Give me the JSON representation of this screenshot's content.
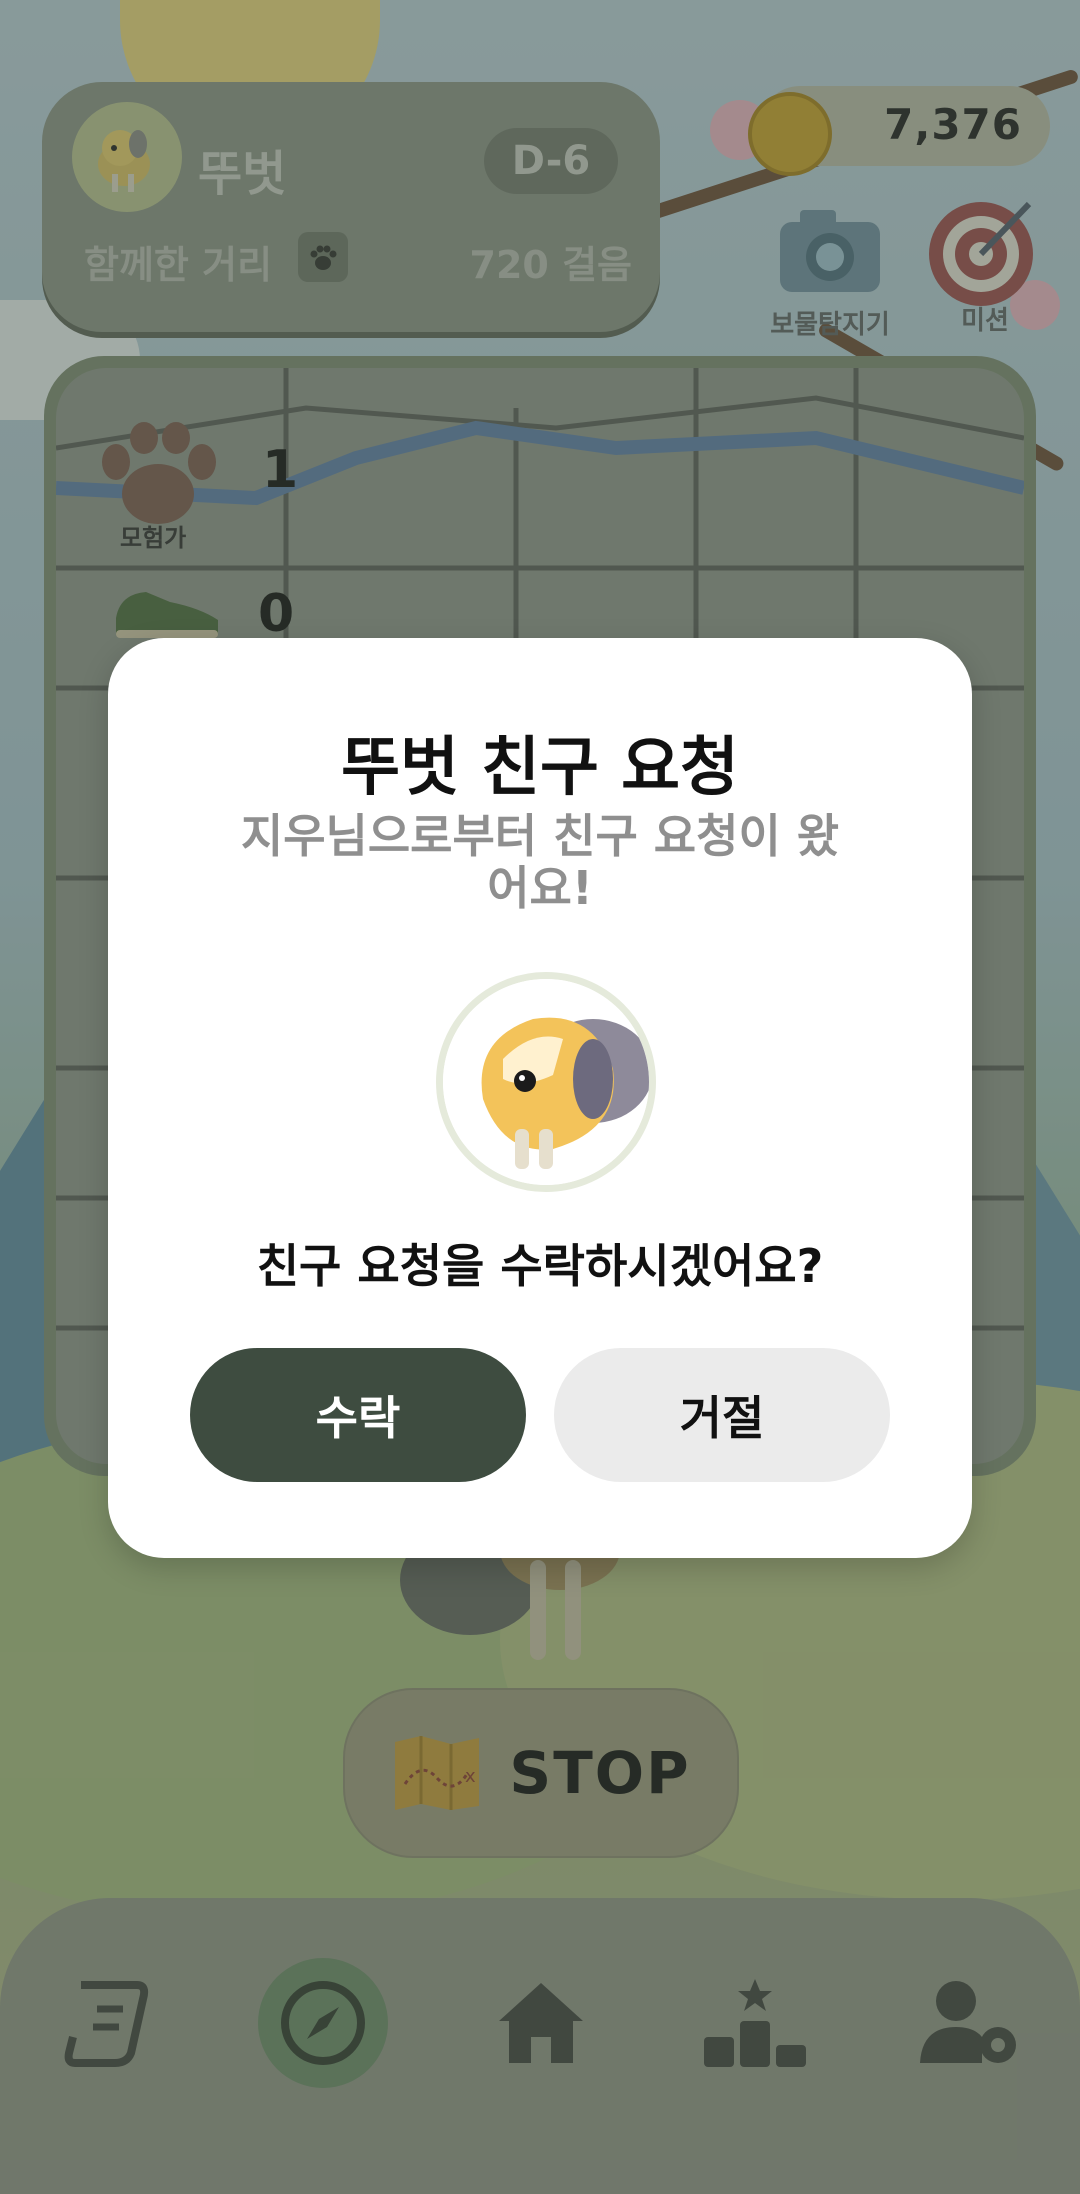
{
  "header": {
    "dog_name": "뚜벗",
    "d_day": "D-6",
    "distance_label": "함께한 거리",
    "steps": "720 걸음"
  },
  "coins": {
    "count": "7,376"
  },
  "quick_actions": [
    {
      "label": "보물탐지기",
      "icon": "camera-icon"
    },
    {
      "label": "미션",
      "icon": "target-icon"
    }
  ],
  "map": {
    "rows": [
      {
        "badge": "모험가",
        "icon": "paw-icon",
        "count": "1"
      },
      {
        "badge": "",
        "icon": "shoe-icon",
        "count": "0"
      }
    ]
  },
  "stop_button": {
    "label": "STOP",
    "icon": "treasure-map-icon"
  },
  "bottom_nav": [
    {
      "name": "quest",
      "icon": "scroll-icon",
      "active": false
    },
    {
      "name": "explore",
      "icon": "compass-icon",
      "active": true
    },
    {
      "name": "home",
      "icon": "home-icon",
      "active": false
    },
    {
      "name": "ranking",
      "icon": "podium-icon",
      "active": false
    },
    {
      "name": "settings",
      "icon": "user-gear-icon",
      "active": false
    }
  ],
  "modal": {
    "title": "뚜벗 친구 요청",
    "subtitle": "지우님으로부터 친구 요청이 왔어요!",
    "question": "친구 요청을 수락하시겠어요?",
    "accept_label": "수락",
    "reject_label": "거절"
  },
  "colors": {
    "accent_dark_green": "#3e4c40",
    "reject_gray": "#ebebeb",
    "modal_bg": "#ffffff",
    "subtitle_gray": "#8f8f8f"
  }
}
